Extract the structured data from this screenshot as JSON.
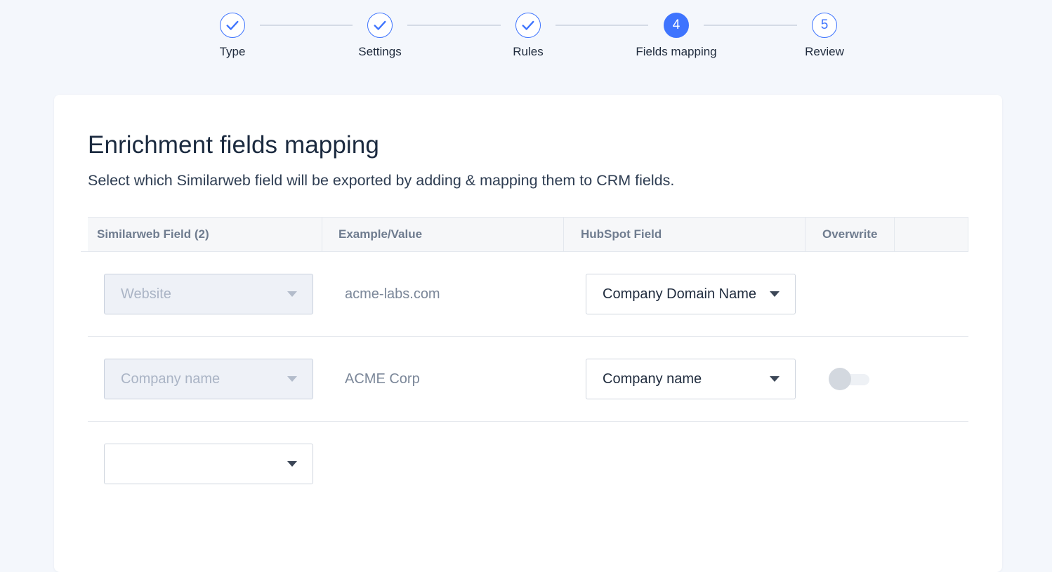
{
  "stepper": {
    "steps": [
      {
        "label": "Type",
        "state": "done",
        "icon": "check-icon"
      },
      {
        "label": "Settings",
        "state": "done",
        "icon": "check-icon"
      },
      {
        "label": "Rules",
        "state": "done",
        "icon": "check-icon"
      },
      {
        "label": "Fields mapping",
        "number": "4",
        "state": "active"
      },
      {
        "label": "Review",
        "number": "5",
        "state": "upcoming"
      }
    ]
  },
  "colors": {
    "accent": "#3e74fe",
    "page_background": "#f4f7fc",
    "card_background": "#ffffff"
  },
  "card": {
    "title": "Enrichment fields mapping",
    "subtitle": "Select which Similarweb field will be exported by adding & mapping them to CRM fields."
  },
  "table": {
    "headers": {
      "similarweb_field": "Similarweb Field (2)",
      "example_value": "Example/Value",
      "hubspot_field": "HubSpot Field",
      "overwrite": "Overwrite"
    },
    "rows": [
      {
        "similarweb_field": "Website",
        "similarweb_disabled": true,
        "example": "acme-labs.com",
        "hubspot_field": "Company Domain Name",
        "overwrite_toggle": false
      },
      {
        "similarweb_field": "Company name",
        "similarweb_disabled": true,
        "example": "ACME Corp",
        "hubspot_field": "Company name",
        "overwrite_toggle": true,
        "overwrite_on": false
      },
      {
        "similarweb_field": "",
        "similarweb_disabled": false
      }
    ]
  }
}
